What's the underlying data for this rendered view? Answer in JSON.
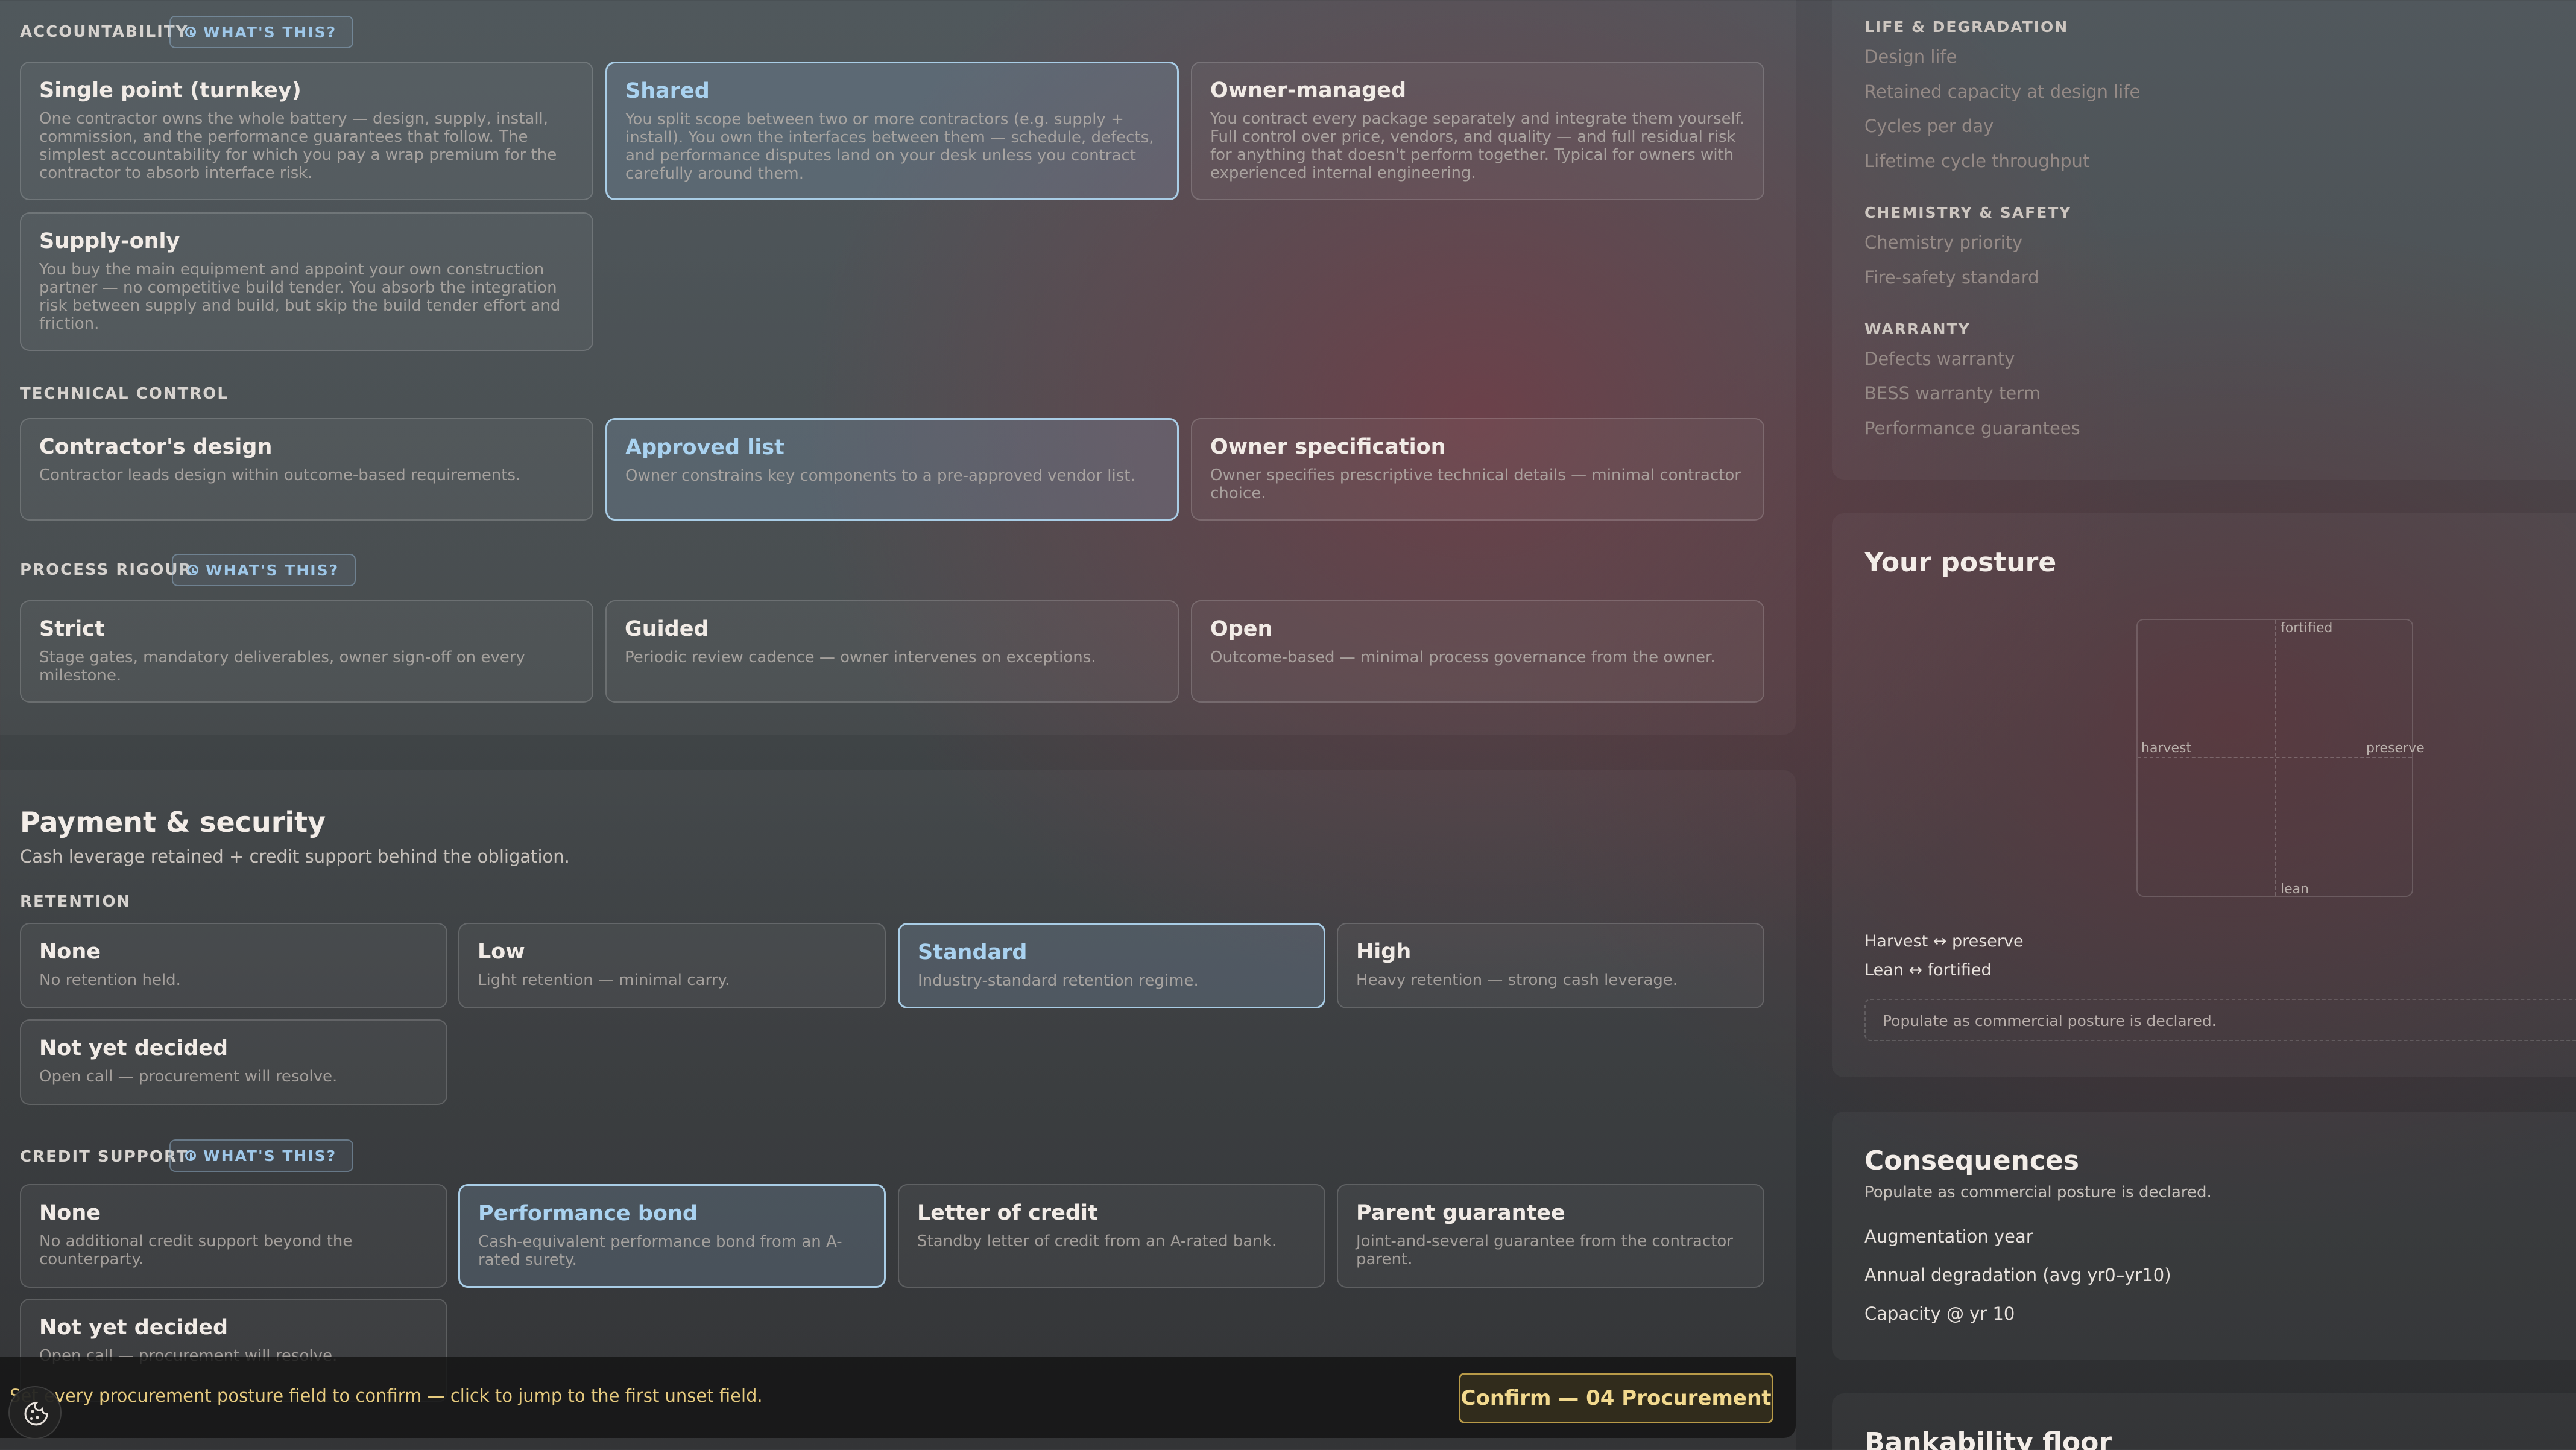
{
  "procurement": {
    "accountability": {
      "label": "ACCOUNTABILITY",
      "help": "WHAT'S THIS?",
      "options": [
        {
          "title": "Single point (turnkey)",
          "desc": "One contractor owns the whole battery — design, supply, install, commission, and the performance guarantees that follow. The simplest accountability for which you pay a wrap premium for the contractor to absorb interface risk."
        },
        {
          "title": "Shared",
          "desc": "You split scope between two or more contractors (e.g. supply + install). You own the interfaces between them — schedule, defects, and performance disputes land on your desk unless you contract carefully around them."
        },
        {
          "title": "Owner-managed",
          "desc": "You contract every package separately and integrate them yourself. Full control over price, vendors, and quality — and full residual risk for anything that doesn't perform together. Typical for owners with experienced internal engineering."
        },
        {
          "title": "Supply-only",
          "desc": "You buy the main equipment and appoint your own construction partner — no competitive build tender. You absorb the integration risk between supply and build, but skip the build tender effort and friction."
        }
      ]
    },
    "technical": {
      "label": "TECHNICAL CONTROL",
      "options": [
        {
          "title": "Contractor's design",
          "desc": "Contractor leads design within outcome-based requirements."
        },
        {
          "title": "Approved list",
          "desc": "Owner constrains key components to a pre-approved vendor list."
        },
        {
          "title": "Owner specification",
          "desc": "Owner specifies prescriptive technical details — minimal contractor choice."
        }
      ]
    },
    "rigour": {
      "label": "PROCESS RIGOUR",
      "help": "WHAT'S THIS?",
      "options": [
        {
          "title": "Strict",
          "desc": "Stage gates, mandatory deliverables, owner sign-off on every milestone."
        },
        {
          "title": "Guided",
          "desc": "Periodic review cadence — owner intervenes on exceptions."
        },
        {
          "title": "Open",
          "desc": "Outcome-based — minimal process governance from the owner."
        }
      ]
    }
  },
  "payment": {
    "title": "Payment & security",
    "subtitle": "Cash leverage retained + credit support behind the obligation.",
    "retention": {
      "label": "RETENTION",
      "options": [
        {
          "title": "None",
          "desc": "No retention held."
        },
        {
          "title": "Low",
          "desc": "Light retention — minimal carry."
        },
        {
          "title": "Standard",
          "desc": "Industry-standard retention regime."
        },
        {
          "title": "High",
          "desc": "Heavy retention — strong cash leverage."
        },
        {
          "title": "Not yet decided",
          "desc": "Open call — procurement will resolve."
        }
      ]
    },
    "credit": {
      "label": "CREDIT SUPPORT",
      "help": "WHAT'S THIS?",
      "options": [
        {
          "title": "None",
          "desc": "No additional credit support beyond the counterparty."
        },
        {
          "title": "Performance bond",
          "desc": "Cash-equivalent performance bond from an A-rated surety."
        },
        {
          "title": "Letter of credit",
          "desc": "Standby letter of credit from an A-rated bank."
        },
        {
          "title": "Parent guarantee",
          "desc": "Joint-and-several guarantee from the contractor parent."
        },
        {
          "title": "Not yet decided",
          "desc": "Open call — procurement will resolve."
        }
      ]
    }
  },
  "confirm": {
    "message": "Set every procurement posture field to confirm — click to jump to the first unset field.",
    "button": "Confirm — 04 Procurement"
  },
  "sidebar": {
    "checklist": [
      {
        "heading": "LIFE & DEGRADATION",
        "items": [
          "Design life",
          "Retained capacity at design life",
          "Cycles per day",
          "Lifetime cycle throughput"
        ]
      },
      {
        "heading": "CHEMISTRY & SAFETY",
        "items": [
          "Chemistry priority",
          "Fire-safety standard"
        ]
      },
      {
        "heading": "WARRANTY",
        "items": [
          "Defects warranty",
          "BESS warranty term",
          "Performance guarantees"
        ]
      }
    ],
    "posture": {
      "title": "Your posture",
      "axis_top": "fortified",
      "axis_bottom": "lean",
      "axis_left": "harvest",
      "axis_right": "preserve",
      "legend_1": "Harvest ↔ preserve",
      "legend_2": "Lean ↔ fortified",
      "hint": "Populate as commercial posture is declared."
    },
    "consequences": {
      "title": "Consequences",
      "subtitle": "Populate as commercial posture is declared.",
      "items": [
        "Augmentation year",
        "Annual degradation (avg yr0–yr10)",
        "Capacity @ yr 10"
      ]
    },
    "bankability": {
      "title": "Bankability floor"
    }
  },
  "colors": {
    "selected_border": "#a9cde6",
    "confirm_text": "#e6ca7e",
    "confirm_border": "#b89a48"
  }
}
